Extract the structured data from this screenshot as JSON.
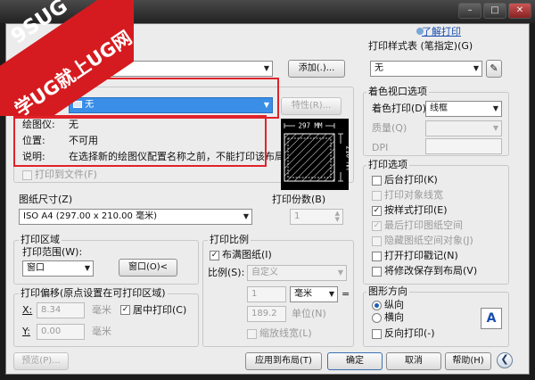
{
  "watermark": {
    "line1": "9SUG",
    "line2": "学UG就上UG网"
  },
  "help_link": "了解打印",
  "page_setup": {
    "name_value": "无>",
    "add_button": "添加(.)..."
  },
  "printer": {
    "group_title": "绘图仪",
    "name_label": "名称(M):",
    "name_value": "无",
    "properties_button": "特性(R)...",
    "plotter_label": "绘图仪:",
    "plotter_value": "无",
    "location_label": "位置:",
    "location_value": "不可用",
    "desc_label": "说明:",
    "desc_value": "在选择新的绘图仪配置名称之前，不能打印该布局。",
    "plot_to_file": "打印到文件(F)",
    "preview": {
      "width": "297 MM",
      "height": "210 MM"
    }
  },
  "paper_size": {
    "label": "图纸尺寸(Z)",
    "value": "ISO A4 (297.00 x 210.00 毫米)"
  },
  "copies": {
    "label": "打印份数(B)",
    "value": "1"
  },
  "plot_area": {
    "title": "打印区域",
    "range_label": "打印范围(W):",
    "range_value": "窗口",
    "window_button": "窗口(O)<"
  },
  "plot_offset": {
    "title": "打印偏移(原点设置在可打印区域)",
    "x_label": "X:",
    "x_value": "8.34",
    "x_unit": "毫米",
    "y_label": "Y:",
    "y_value": "0.00",
    "y_unit": "毫米",
    "center_label": "居中打印(C)"
  },
  "plot_scale": {
    "title": "打印比例",
    "fit_label": "布满图纸(I)",
    "scale_label": "比例(S):",
    "scale_value": "自定义",
    "value1": "1",
    "unit_value": "毫米",
    "equals": "=",
    "value2": "189.2",
    "unit_label": "单位(N)",
    "lineweights_label": "缩放线宽(L)"
  },
  "plot_style_table": {
    "title": "打印样式表 (笔指定)(G)",
    "value": "无"
  },
  "shaded_viewport": {
    "title": "着色视口选项",
    "shade_label": "着色打印(D)",
    "shade_value": "线框",
    "quality_label": "质量(Q)",
    "dpi_label": "DPI"
  },
  "plot_options": {
    "title": "打印选项",
    "items": [
      {
        "label": "后台打印(K)",
        "checked": false,
        "enabled": true
      },
      {
        "label": "打印对象线宽",
        "checked": false,
        "enabled": false
      },
      {
        "label": "按样式打印(E)",
        "checked": true,
        "enabled": true
      },
      {
        "label": "最后打印图纸空间",
        "checked": true,
        "enabled": false
      },
      {
        "label": "隐藏图纸空间对象(J)",
        "checked": false,
        "enabled": false
      },
      {
        "label": "打开打印戳记(N)",
        "checked": false,
        "enabled": true
      },
      {
        "label": "将修改保存到布局(V)",
        "checked": false,
        "enabled": true
      }
    ]
  },
  "orientation": {
    "title": "图形方向",
    "portrait": "纵向",
    "landscape": "横向",
    "upside_down": "反向打印(-)",
    "icon_letter": "A"
  },
  "footer": {
    "preview": "预览(P)...",
    "apply": "应用到布局(T)",
    "ok": "确定",
    "cancel": "取消",
    "help": "帮助(H)"
  },
  "colors": {
    "watermark_red": "#d51b1f",
    "highlight_red": "#e0232b",
    "selection_blue": "#3a8ee6"
  }
}
